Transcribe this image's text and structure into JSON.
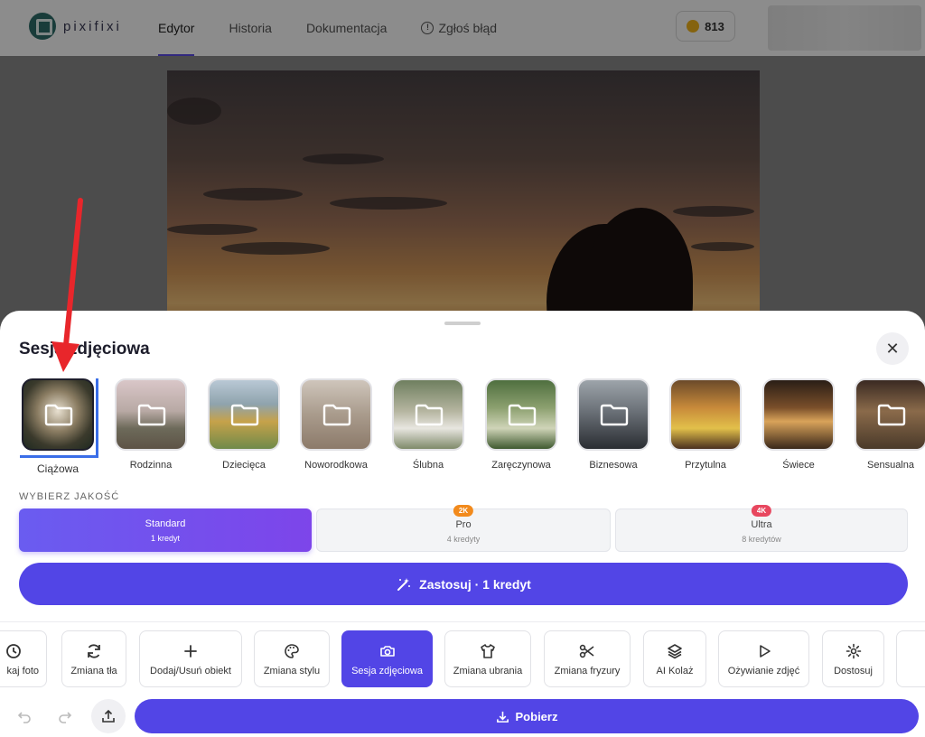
{
  "header": {
    "logo_text": "pixifixi",
    "nav": [
      {
        "label": "Edytor",
        "active": true
      },
      {
        "label": "Historia",
        "active": false
      },
      {
        "label": "Dokumentacja",
        "active": false
      },
      {
        "label": "Zgłoś błąd",
        "active": false,
        "icon": "info-icon"
      }
    ],
    "credits": "813"
  },
  "sheet": {
    "title": "Sesja zdjęciowa",
    "close_icon": "close-icon",
    "categories": [
      {
        "label": "Ciążowa",
        "selected": true
      },
      {
        "label": "Rodzinna"
      },
      {
        "label": "Dziecięca"
      },
      {
        "label": "Noworodkowa"
      },
      {
        "label": "Ślubna"
      },
      {
        "label": "Zaręczynowa"
      },
      {
        "label": "Biznesowa"
      },
      {
        "label": "Przytulna"
      },
      {
        "label": "Świece"
      },
      {
        "label": "Sensualna"
      }
    ],
    "quality": {
      "label": "WYBIERZ JAKOŚĆ",
      "options": [
        {
          "name": "Standard",
          "sub": "1 kredyt",
          "active": true
        },
        {
          "name": "Pro",
          "sub": "4 kredyty",
          "badge": "2K",
          "badge_color": "#f28a1c"
        },
        {
          "name": "Ultra",
          "sub": "8 kredytów",
          "badge": "4K",
          "badge_color": "#e8475f"
        }
      ]
    },
    "apply_label": "Zastosuj · 1 kredyt"
  },
  "tools": [
    {
      "label": "kaj foto",
      "icon": "history-icon"
    },
    {
      "label": "Zmiana tła",
      "icon": "refresh-icon"
    },
    {
      "label": "Dodaj/Usuń obiekt",
      "icon": "plus-icon"
    },
    {
      "label": "Zmiana stylu",
      "icon": "palette-icon"
    },
    {
      "label": "Sesja zdjęciowa",
      "icon": "camera-icon",
      "active": true
    },
    {
      "label": "Zmiana ubrania",
      "icon": "shirt-icon"
    },
    {
      "label": "Zmiana fryzury",
      "icon": "scissors-icon"
    },
    {
      "label": "AI Kolaż",
      "icon": "layers-icon"
    },
    {
      "label": "Ożywianie zdjęć",
      "icon": "play-icon"
    },
    {
      "label": "Dostosuj",
      "icon": "gear-icon"
    }
  ],
  "bottom": {
    "download_label": "Pobierz"
  },
  "colors": {
    "accent": "#5245e6",
    "selection": "#3a6ee8",
    "annotation": "#e8262b"
  }
}
